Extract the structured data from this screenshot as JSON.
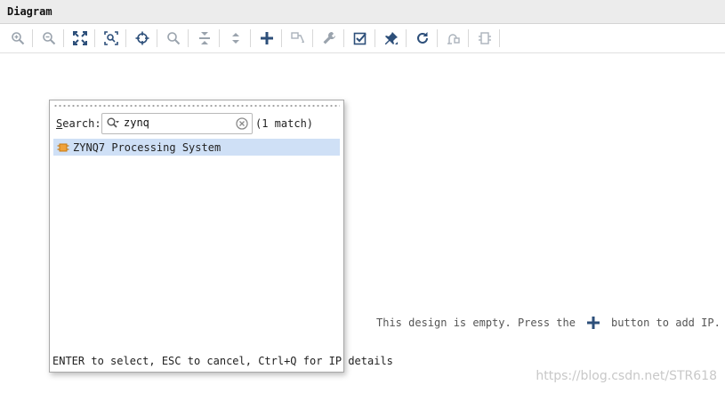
{
  "window": {
    "title": "Diagram"
  },
  "toolbar": {
    "buttons": [
      {
        "name": "zoom-in-icon"
      },
      {
        "name": "zoom-out-icon"
      },
      {
        "name": "zoom-fit-icon"
      },
      {
        "name": "zoom-area-icon"
      },
      {
        "name": "selection-zoom-icon"
      },
      {
        "name": "search-icon"
      },
      {
        "name": "collapse-all-icon"
      },
      {
        "name": "expand-all-icon"
      },
      {
        "name": "add-ip-icon"
      },
      {
        "name": "make-connection-icon"
      },
      {
        "name": "wrench-icon"
      },
      {
        "name": "validate-design-icon"
      },
      {
        "name": "pin-icon"
      },
      {
        "name": "refresh-icon"
      },
      {
        "name": "regenerate-layout-icon"
      },
      {
        "name": "create-port-icon"
      }
    ]
  },
  "canvas": {
    "empty_message_before": "This design is empty. Press the",
    "empty_message_after": "button to add IP.",
    "watermark": "https://blog.csdn.net/STR618"
  },
  "popup": {
    "search_label_prefix": "S",
    "search_label_rest": "earch:",
    "search_value": "zynq",
    "match_count": "(1 match)",
    "results": [
      {
        "label": "ZYNQ7 Processing System",
        "icon": "ip-core-icon"
      }
    ],
    "hint": "ENTER to select, ESC to cancel, Ctrl+Q for IP details"
  }
}
